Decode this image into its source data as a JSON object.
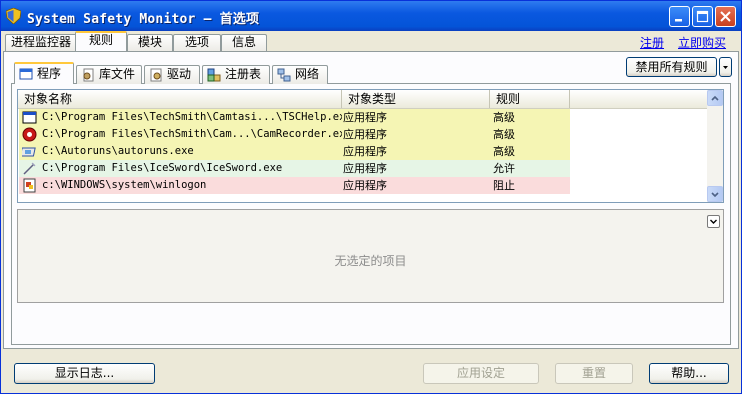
{
  "window": {
    "title": "System Safety Monitor — 首选项",
    "colors": {
      "titlebar": "#0a58e0",
      "accent_tab": "#ffc83c",
      "row_yellow": "#f5f5b4",
      "row_green": "#e6f5e6",
      "row_red": "#fadcdc"
    }
  },
  "main_tabs": [
    {
      "label": "进程监控器"
    },
    {
      "label": "规则",
      "active": true
    },
    {
      "label": "模块"
    },
    {
      "label": "选项"
    },
    {
      "label": "信息"
    }
  ],
  "links": {
    "register": "注册",
    "buy_now": "立即购买"
  },
  "sub_tabs": [
    {
      "label": "程序",
      "icon": "program-icon",
      "active": true
    },
    {
      "label": "库文件",
      "icon": "library-icon"
    },
    {
      "label": "驱动",
      "icon": "driver-icon"
    },
    {
      "label": "注册表",
      "icon": "registry-icon"
    },
    {
      "label": "网络",
      "icon": "network-icon"
    }
  ],
  "disable_all_rules_button": "禁用所有规则",
  "table": {
    "columns": [
      "对象名称",
      "对象类型",
      "规则"
    ],
    "rows": [
      {
        "icon": "window-app-icon",
        "object": "C:\\Program Files\\TechSmith\\Camtasi...\\TSCHelp.exe",
        "type": "应用程序",
        "rule": "高级",
        "status": "advanced"
      },
      {
        "icon": "camrecorder-icon",
        "object": "C:\\Program Files\\TechSmith\\Cam...\\CamRecorder.exe",
        "type": "应用程序",
        "rule": "高级",
        "status": "advanced"
      },
      {
        "icon": "autoruns-icon",
        "object": "C:\\Autoruns\\autoruns.exe",
        "type": "应用程序",
        "rule": "高级",
        "status": "advanced"
      },
      {
        "icon": "icesword-icon",
        "object": "C:\\Program Files\\IceSword\\IceSword.exe",
        "type": "应用程序",
        "rule": "允许",
        "status": "allow"
      },
      {
        "icon": "winlogon-icon",
        "object": "c:\\WINDOWS\\system\\winlogon",
        "type": "应用程序",
        "rule": "阻止",
        "status": "block"
      }
    ]
  },
  "detail": {
    "empty_message": "无选定的项目"
  },
  "bottom": {
    "show_log": "显示日志...",
    "apply": "应用设定",
    "reset": "重置",
    "help": "帮助..."
  }
}
